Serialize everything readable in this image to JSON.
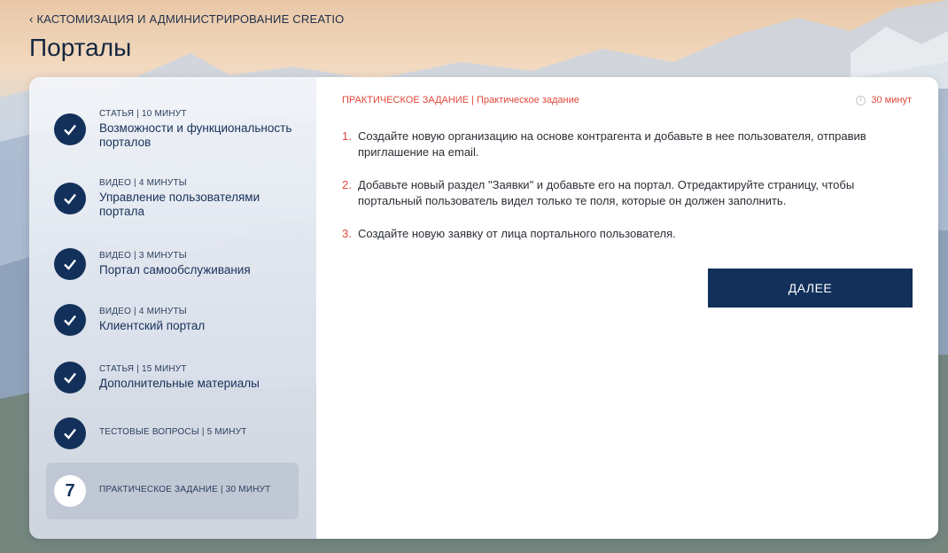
{
  "breadcrumb": {
    "label": "КАСТОМИЗАЦИЯ И АДМИНИСТРИРОВАНИЕ CREATIO"
  },
  "page": {
    "title": "Порталы"
  },
  "steps": [
    {
      "meta": "СТАТЬЯ | 10 МИНУТ",
      "title": "Возможности и функциональность порталов",
      "status": "completed"
    },
    {
      "meta": "ВИДЕО | 4 МИНУТЫ",
      "title": "Управление пользователями портала",
      "status": "completed"
    },
    {
      "meta": "ВИДЕО | 3 МИНУТЫ",
      "title": "Портал самообслуживания",
      "status": "completed"
    },
    {
      "meta": "ВИДЕО | 4 МИНУТЫ",
      "title": "Клиентский портал",
      "status": "completed"
    },
    {
      "meta": "СТАТЬЯ | 15 МИНУТ",
      "title": "Дополнительные материалы",
      "status": "completed"
    },
    {
      "meta": "ТЕСТОВЫЕ ВОПРОСЫ | 5 МИНУТ",
      "title": "",
      "status": "completed"
    },
    {
      "meta": "ПРАКТИЧЕСКОЕ ЗАДАНИЕ | 30 МИНУТ",
      "title": "",
      "status": "active",
      "number": "7"
    }
  ],
  "main": {
    "header": "ПРАКТИЧЕСКОЕ ЗАДАНИЕ | Практическое задание",
    "duration": "30 минут",
    "tasks": [
      {
        "index": "1.",
        "text": "Создайте новую организацию на основе контрагента и добавьте в нее пользователя, отправив приглашение на email."
      },
      {
        "index": "2.",
        "text": "Добавьте новый раздел \"Заявки\" и добавьте его на портал. Отредактируйте страницу, чтобы портальный пользователь видел только те поля, которые он должен заполнить."
      },
      {
        "index": "3.",
        "text": "Создайте новую заявку от лица портального пользователя."
      }
    ],
    "next_label": "ДАЛЕЕ"
  },
  "colors": {
    "accent": "#e0473a",
    "primary": "#12305a"
  }
}
